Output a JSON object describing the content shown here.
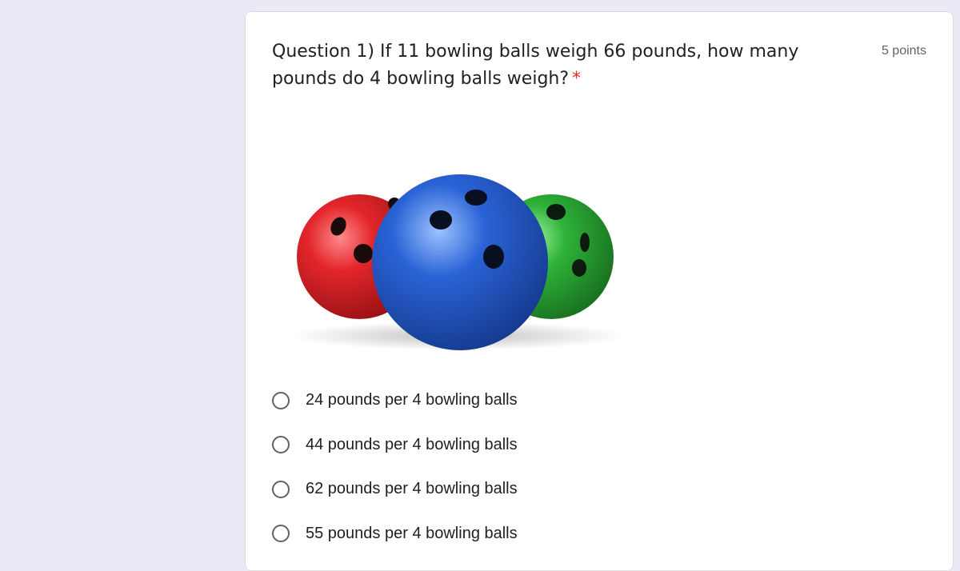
{
  "question": {
    "title": "Question 1) If 11 bowling balls weigh 66 pounds, how many pounds do 4 bowling balls weigh?",
    "required_marker": "*",
    "points": "5 points"
  },
  "image": {
    "description_icon": "bowling-balls-image"
  },
  "options": [
    {
      "label": "24 pounds per 4 bowling balls"
    },
    {
      "label": "44 pounds per 4 bowling balls"
    },
    {
      "label": "62 pounds per 4 bowling balls"
    },
    {
      "label": "55 pounds per 4 bowling balls"
    }
  ],
  "colors": {
    "background": "#ede8f6",
    "required": "#d93025",
    "ball_red": "#e3262b",
    "ball_blue": "#2a63d6",
    "ball_green": "#2fb33a"
  }
}
